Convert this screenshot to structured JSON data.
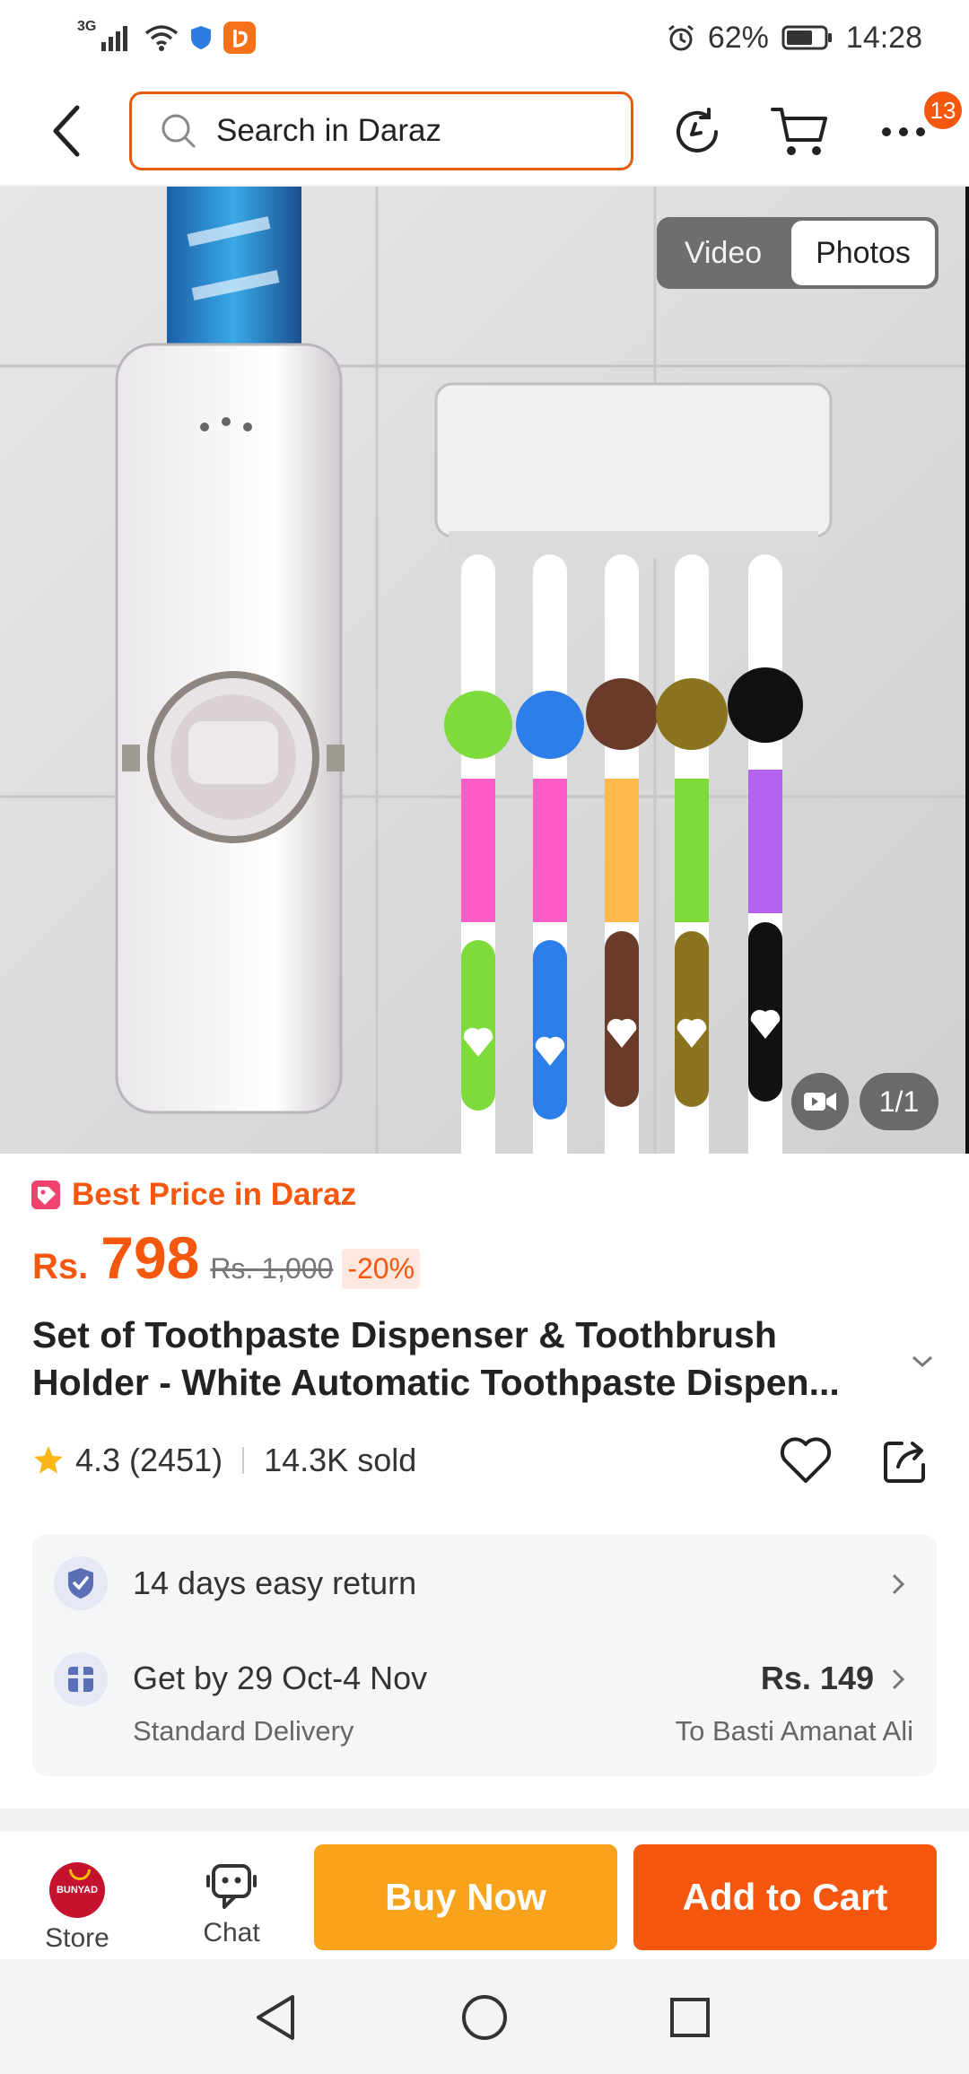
{
  "status_bar": {
    "network": "3G",
    "battery": "62%",
    "time": "14:28"
  },
  "header": {
    "search_placeholder": "Search in Daraz",
    "cart_count": "13",
    "icons": [
      "back-arrow-icon",
      "search-icon",
      "history-icon",
      "cart-icon",
      "more-icon"
    ]
  },
  "gallery": {
    "toggle_video": "Video",
    "toggle_photos": "Photos",
    "counter": "1/1"
  },
  "product": {
    "badge": "Best Price in Daraz",
    "currency": "Rs.",
    "price": "798",
    "old_price": "Rs. 1,000",
    "discount": "-20%",
    "title_line1": "Set of Toothpaste Dispenser & Toothbrush",
    "title_line2": "Holder - White Automatic Toothpaste Dispen...",
    "rating": "4.3 (2451)",
    "sold": "14.3K sold",
    "rating_star": 4.3
  },
  "services": {
    "return_text": "14 days easy return",
    "delivery_date": "Get by 29 Oct-4 Nov",
    "delivery_type": "Standard Delivery",
    "delivery_price": "Rs. 149",
    "delivery_destination": "To Basti Amanat Ali"
  },
  "actions": {
    "store_label": "Store",
    "store_logo_text": "BUNYAD",
    "chat_label": "Chat",
    "buy_now": "Buy Now",
    "add_to_cart": "Add to Cart"
  },
  "colors": {
    "accent": "#f5570e",
    "buy_now": "#f9a21b",
    "search_border": "#e85a0e"
  }
}
